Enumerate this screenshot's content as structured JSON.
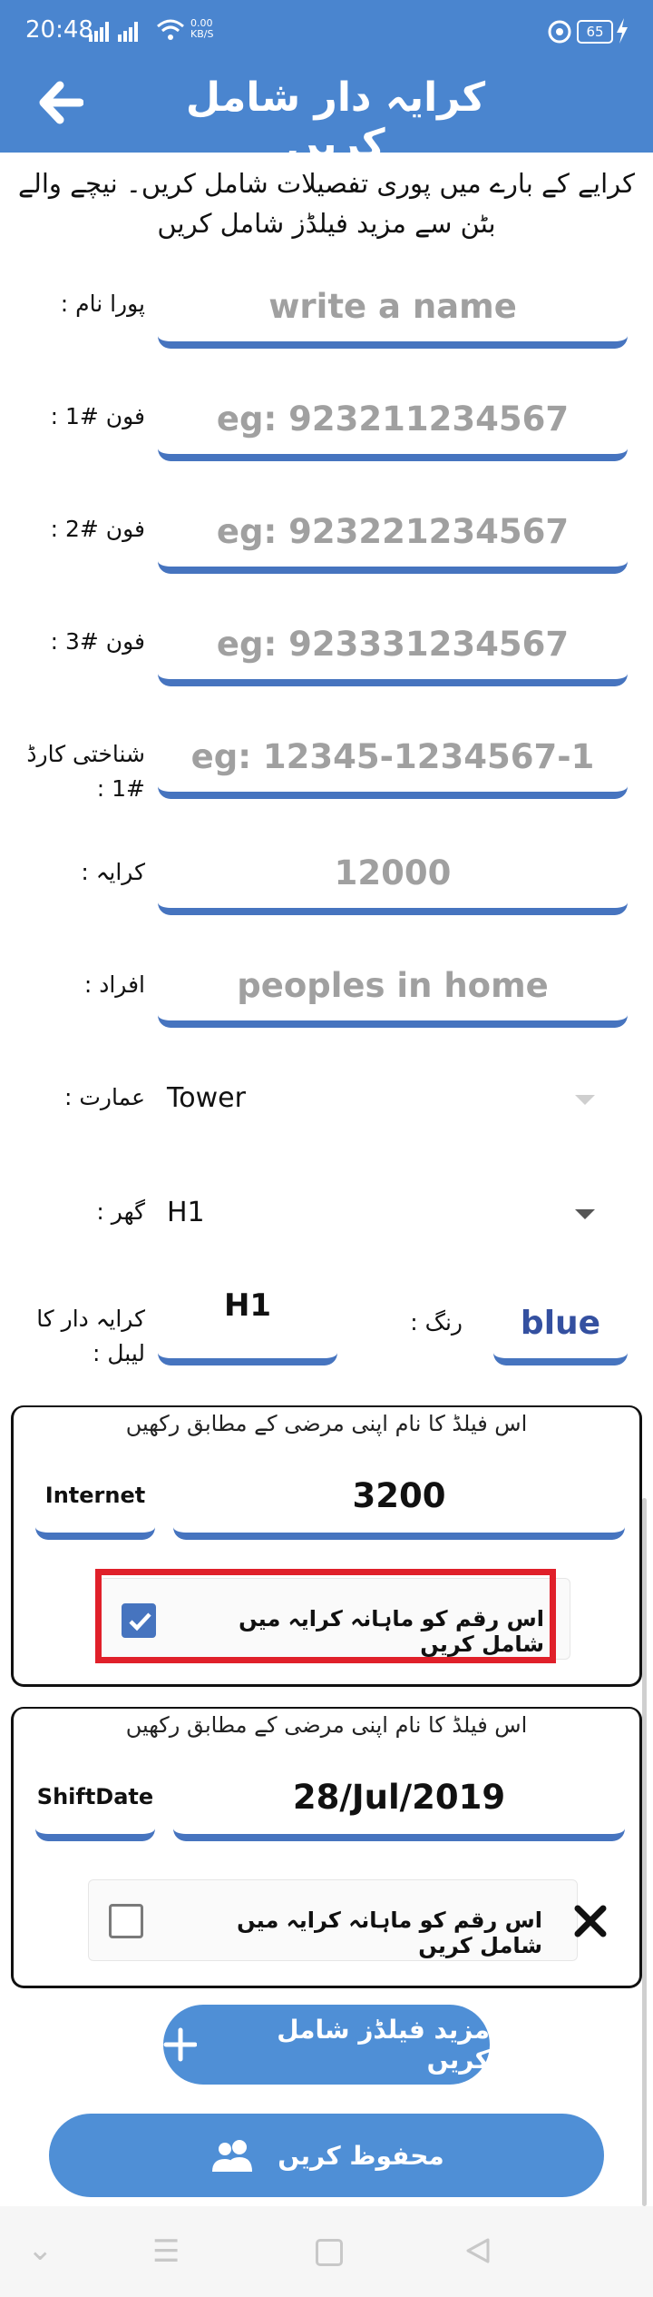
{
  "status_bar": {
    "time": "20:48",
    "network_speed": "0.00\nKB/S",
    "battery": "65"
  },
  "app_bar": {
    "title": "کرایہ دار شامل کریں",
    "back_icon": "arrow-left-icon"
  },
  "intro_text": "کرایے کے بارے میں پوری تفصیلات شامل کریں۔ نیچے والے بٹن سے مزید فیلڈز شامل کریں",
  "form": {
    "full_name": {
      "label": "پورا نام :",
      "placeholder": "write a name"
    },
    "phone1": {
      "label": "فون #1 :",
      "placeholder": "eg: 923211234567"
    },
    "phone2": {
      "label": "فون #2 :",
      "placeholder": "eg: 923221234567"
    },
    "phone3": {
      "label": "فون #3 :",
      "placeholder": "eg: 923331234567"
    },
    "cnic": {
      "label": "شناختی کارڈ #1 :",
      "placeholder": "eg: 12345-1234567-1"
    },
    "rent": {
      "label": "کرایہ :",
      "placeholder": "12000"
    },
    "persons": {
      "label": "افراد :",
      "placeholder": "peoples in home"
    },
    "building": {
      "label": "عمارت :",
      "value": "Tower"
    },
    "house": {
      "label": "گھر :",
      "value": "H1"
    },
    "tenant_label": {
      "label": "کرایہ دار کا لیبل :",
      "value": "H1"
    },
    "color": {
      "label": "رنگ :",
      "value": "blue",
      "value_color": "#3450a0"
    }
  },
  "custom_fields": [
    {
      "hint": "اس فیلڈ کا نام اپنی مرضی کے مطابق رکھیں",
      "name": "Internet",
      "value": "3200",
      "checkbox_label": "اس رقم کو ماہانہ کرایہ میں شامل کریں",
      "checked": true,
      "highlighted": true
    },
    {
      "hint": "اس فیلڈ کا نام اپنی مرضی کے مطابق رکھیں",
      "name": "ShiftDate",
      "value": "28/Jul/2019",
      "checkbox_label": "اس رقم کو ماہانہ کرایہ میں شامل کریں",
      "checked": false,
      "remove_icon": "close-x-icon"
    }
  ],
  "buttons": {
    "add_fields": "مزید فیلڈز شامل کریں",
    "save": "محفوظ کریں"
  },
  "colors": {
    "primary": "#4a85cf",
    "underline": "#4674bf",
    "highlight_border": "#e0202a"
  }
}
